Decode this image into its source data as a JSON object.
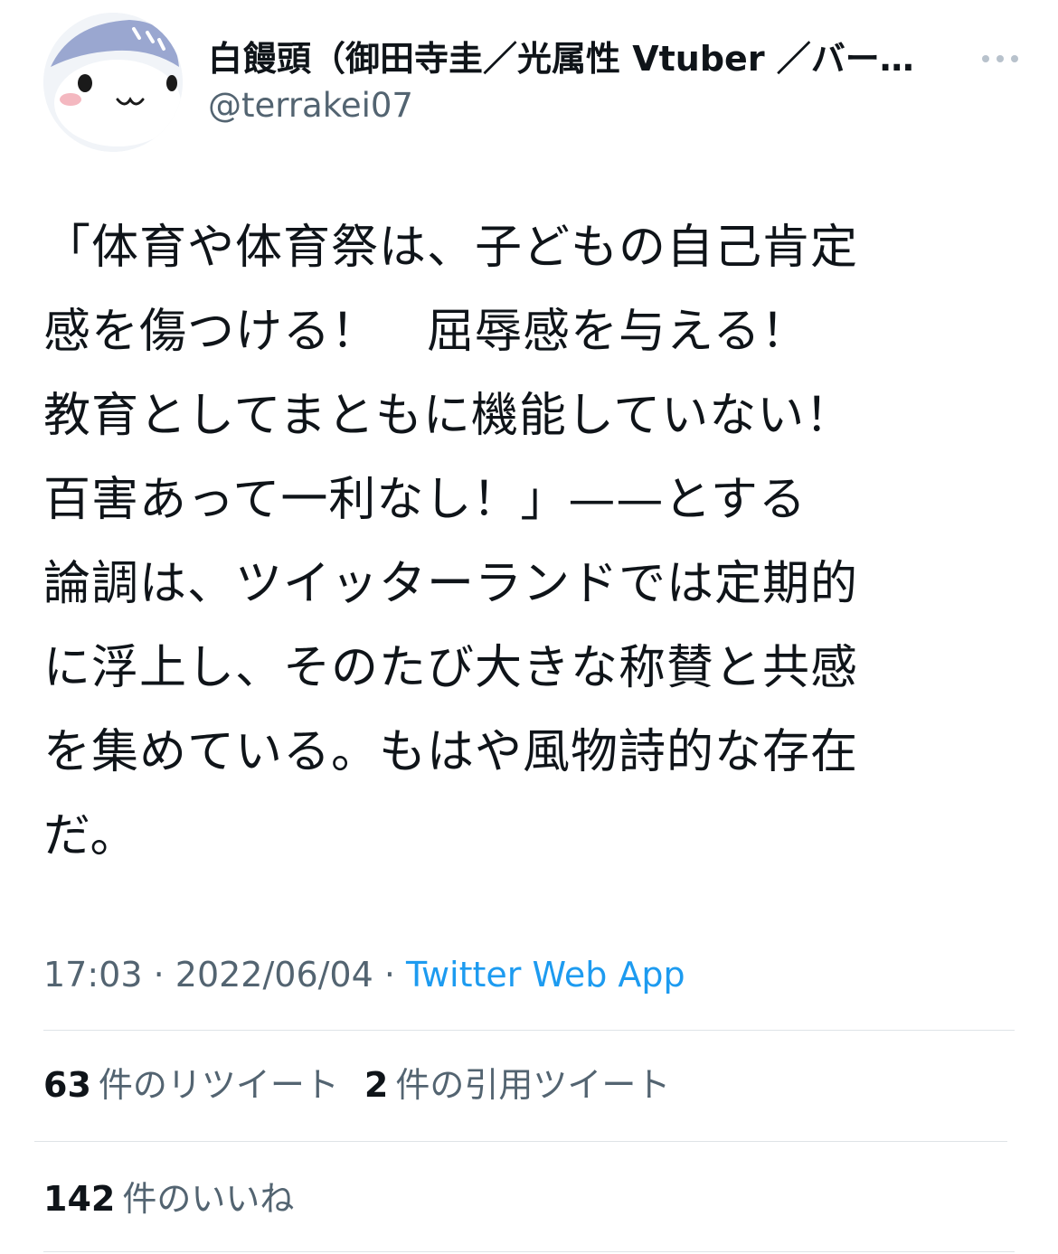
{
  "author": {
    "display_name": "白饅頭（御田寺圭／光属性 Vtuber ／バー…",
    "handle": "@terrakei07",
    "avatar_icon": "mascot-avatar-icon"
  },
  "tweet": {
    "text": "「体育や体育祭は、子どもの自己肯定\n感を傷つける！　屈辱感を与える！\n教育としてまともに機能していない！\n百害あって一利なし！」——とする\n論調は、ツイッターランドでは定期的\nに浮上し、そのたび大きな称賛と共感\nを集めている。もはや風物詩的な存在\nだ。",
    "time": "17:03",
    "sep1": " · ",
    "date": "2022/06/04",
    "sep2": " · ",
    "source": "Twitter Web App"
  },
  "stats": {
    "retweets_count": "63",
    "retweets_label": "件のリツイート",
    "quotes_count": "2",
    "quotes_label": "件の引用ツイート",
    "likes_count": "142",
    "likes_label": "件のいいね"
  },
  "colors": {
    "text": "#0f1419",
    "secondary": "#536471",
    "link": "#1d9bf0",
    "divider": "#dfe3e7"
  }
}
